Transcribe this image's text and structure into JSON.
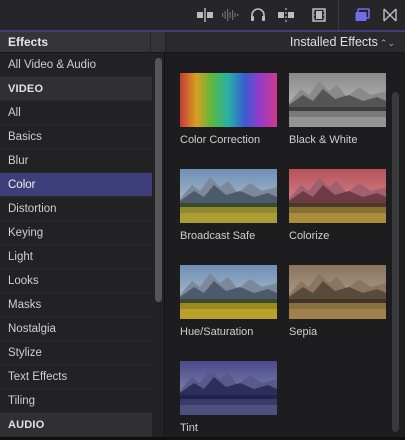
{
  "toolbar": {
    "icons": [
      "clip-trim-icon",
      "audio-waveform-icon",
      "headphones-icon",
      "snapping-icon",
      "filmstrip-icon",
      "browser-view-icon",
      "transitions-icon"
    ]
  },
  "sidebar": {
    "title": "Effects",
    "items": [
      {
        "label": "All Video & Audio",
        "kind": "item"
      },
      {
        "label": "VIDEO",
        "kind": "section"
      },
      {
        "label": "All",
        "kind": "item"
      },
      {
        "label": "Basics",
        "kind": "item"
      },
      {
        "label": "Blur",
        "kind": "item"
      },
      {
        "label": "Color",
        "kind": "item",
        "selected": true
      },
      {
        "label": "Distortion",
        "kind": "item"
      },
      {
        "label": "Keying",
        "kind": "item"
      },
      {
        "label": "Light",
        "kind": "item"
      },
      {
        "label": "Looks",
        "kind": "item"
      },
      {
        "label": "Masks",
        "kind": "item"
      },
      {
        "label": "Nostalgia",
        "kind": "item"
      },
      {
        "label": "Stylize",
        "kind": "item"
      },
      {
        "label": "Text Effects",
        "kind": "item"
      },
      {
        "label": "Tiling",
        "kind": "item"
      },
      {
        "label": "AUDIO",
        "kind": "section"
      }
    ]
  },
  "browser": {
    "filter_label": "Installed Effects",
    "effects": [
      {
        "label": "Color Correction",
        "style": "spectrum"
      },
      {
        "label": "Black & White",
        "style": "bw"
      },
      {
        "label": "Broadcast Safe",
        "style": "normal"
      },
      {
        "label": "Colorize",
        "style": "colorize"
      },
      {
        "label": "Hue/Saturation",
        "style": "huesat"
      },
      {
        "label": "Sepia",
        "style": "sepia"
      },
      {
        "label": "Tint",
        "style": "tint"
      }
    ]
  },
  "colors": {
    "selected_row": "#3e3f7a",
    "accent": "#5a58c8"
  }
}
